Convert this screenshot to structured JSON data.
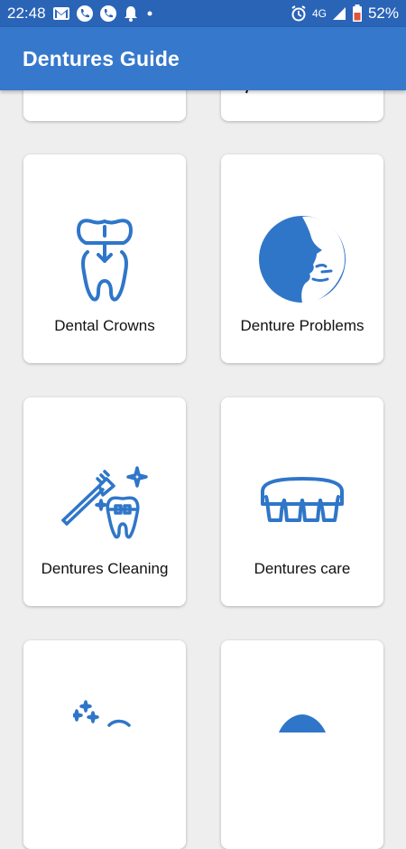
{
  "status_bar": {
    "time": "22:48",
    "network": "4G",
    "battery": "52%",
    "left_icons": [
      "gmail-icon",
      "phone-icon",
      "phone-icon",
      "notification-bell-icon",
      "dot-icon"
    ],
    "right_icons": [
      "alarm-icon",
      "signal-icon",
      "battery-icon"
    ]
  },
  "app_bar": {
    "title": "Dentures Guide"
  },
  "colors": {
    "status_bar": "#2a64b7",
    "app_bar": "#3679cc",
    "icon_blue": "#2f76c8",
    "background": "#eeeeee"
  },
  "cards": [
    {
      "label": "",
      "icon": "partial-card-icon"
    },
    {
      "label": "",
      "icon": "partial-card-icon"
    },
    {
      "label": "Dental Crowns",
      "icon": "dental-crown-icon"
    },
    {
      "label": "Denture Problems",
      "icon": "face-profile-icon"
    },
    {
      "label": "Dentures Cleaning",
      "icon": "toothbrush-sparkle-icon"
    },
    {
      "label": "Dentures care",
      "icon": "denture-arch-icon"
    },
    {
      "label": "",
      "icon": "sparkle-icon"
    },
    {
      "label": "",
      "icon": "circle-icon"
    }
  ]
}
